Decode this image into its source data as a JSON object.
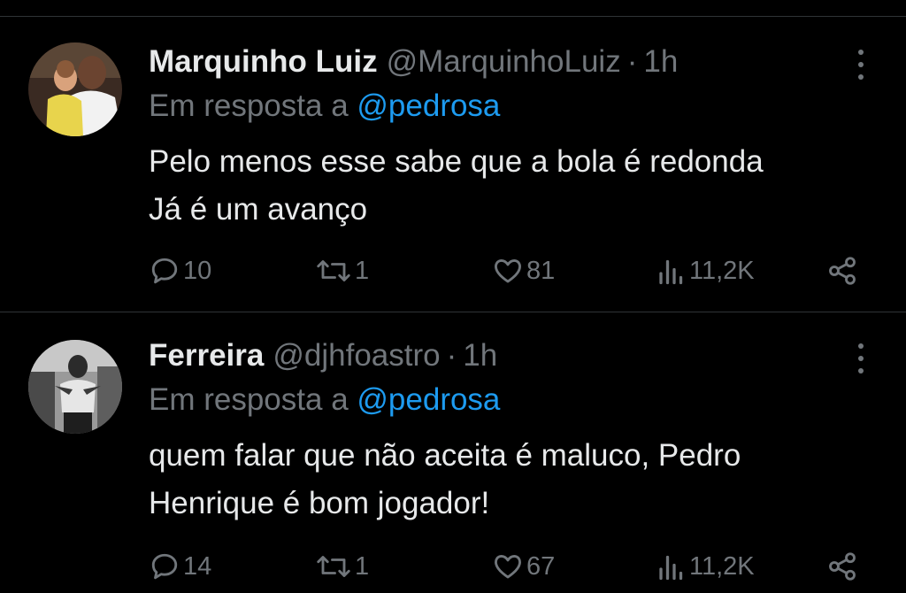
{
  "colors": {
    "background": "#000000",
    "text": "#e7e9ea",
    "muted": "#71767b",
    "link": "#1d9bf0",
    "divider": "#2f3336"
  },
  "tweets": [
    {
      "name": "Marquinho Luiz",
      "handle": "@MarquinhoLuiz",
      "dot": "·",
      "time": "1h",
      "reply_prefix": "Em resposta a",
      "reply_to": "@pedrosa",
      "lines": [
        "Pelo menos esse sabe que a bola é redonda",
        "Já é um avanço"
      ],
      "replies": "10",
      "retweets": "1",
      "likes": "81",
      "views": "11,2K",
      "icons": [
        "reply-icon",
        "retweet-icon",
        "heart-icon",
        "views-icon",
        "share-icon",
        "more-icon"
      ]
    },
    {
      "name": "Ferreira",
      "handle": "@djhfoastro",
      "dot": "·",
      "time": "1h",
      "reply_prefix": "Em resposta a",
      "reply_to": "@pedrosa",
      "lines": [
        "quem falar que não aceita é maluco, Pedro",
        "Henrique é bom jogador!"
      ],
      "replies": "14",
      "retweets": "1",
      "likes": "67",
      "views": "11,2K",
      "icons": [
        "reply-icon",
        "retweet-icon",
        "heart-icon",
        "views-icon",
        "share-icon",
        "more-icon"
      ]
    }
  ]
}
